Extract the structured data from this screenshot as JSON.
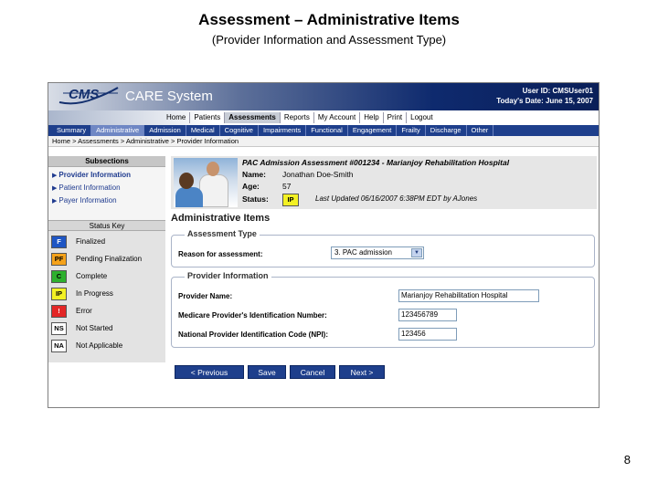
{
  "slide": {
    "title": "Assessment – Administrative Items",
    "subtitle": "(Provider Information and Assessment Type)",
    "page_number": "8"
  },
  "app": {
    "logo_text": "CMS",
    "title": "CARE System",
    "user_id": "User ID: CMSUser01",
    "date": "Today's Date: June 15, 2007"
  },
  "top_menu": [
    {
      "label": "Home"
    },
    {
      "label": "Patients"
    },
    {
      "label": "Assessments",
      "active": true
    },
    {
      "label": "Reports"
    },
    {
      "label": "My Account"
    },
    {
      "label": "Help"
    },
    {
      "label": "Print"
    },
    {
      "label": "Logout"
    }
  ],
  "tabs": [
    {
      "label": "Summary"
    },
    {
      "label": "Administrative",
      "active": true
    },
    {
      "label": "Admission"
    },
    {
      "label": "Medical"
    },
    {
      "label": "Cognitive"
    },
    {
      "label": "Impairments"
    },
    {
      "label": "Functional"
    },
    {
      "label": "Engagement"
    },
    {
      "label": "Frailty"
    },
    {
      "label": "Discharge"
    },
    {
      "label": "Other"
    }
  ],
  "breadcrumb": "Home > Assessments > Administrative > Provider Information",
  "subsections": {
    "heading": "Subsections",
    "items": [
      {
        "label": "Provider Information",
        "current": true
      },
      {
        "label": "Patient Information"
      },
      {
        "label": "Payer Information"
      }
    ]
  },
  "status_key": {
    "heading": "Status Key",
    "items": [
      {
        "code": "F",
        "label": "Finalized",
        "color": "#1f56c4",
        "text_color": "#ffffff"
      },
      {
        "code": "PF",
        "label": "Pending Finalization",
        "color": "#f5a21a",
        "text_color": "#000000"
      },
      {
        "code": "C",
        "label": "Complete",
        "color": "#2eb02e",
        "text_color": "#000000"
      },
      {
        "code": "IP",
        "label": "In Progress",
        "color": "#f3f124",
        "text_color": "#000000"
      },
      {
        "code": "!",
        "label": "Error",
        "color": "#e32626",
        "text_color": "#ffffff"
      },
      {
        "code": "NS",
        "label": "Not Started",
        "color": "#ffffff",
        "text_color": "#000000"
      },
      {
        "code": "NA",
        "label": "Not Applicable",
        "color": "#ffffff",
        "text_color": "#000000"
      }
    ]
  },
  "record": {
    "title": "PAC Admission Assessment #001234 - Marianjoy Rehabilitation Hospital",
    "name_label": "Name:",
    "name": "Jonathan Doe-Smith",
    "age_label": "Age:",
    "age": "57",
    "status_label": "Status:",
    "status": "IP",
    "last_updated": "Last Updated 06/16/2007 6:38PM EDT by AJones"
  },
  "section_title": "Administrative Items",
  "assessment_type": {
    "legend": "Assessment Type",
    "reason_label": "Reason for assessment:",
    "reason_value": "3. PAC admission"
  },
  "provider_info": {
    "legend": "Provider Information",
    "name_label": "Provider Name:",
    "name_value": "Marianjoy Rehabilitation Hospital",
    "medicare_label": "Medicare Provider's Identification Number:",
    "medicare_value": "123456789",
    "npi_label": "National Provider Identification Code (NPI):",
    "npi_value": "123456"
  },
  "buttons": {
    "previous": "< Previous",
    "save": "Save",
    "cancel": "Cancel",
    "next": "Next >"
  }
}
